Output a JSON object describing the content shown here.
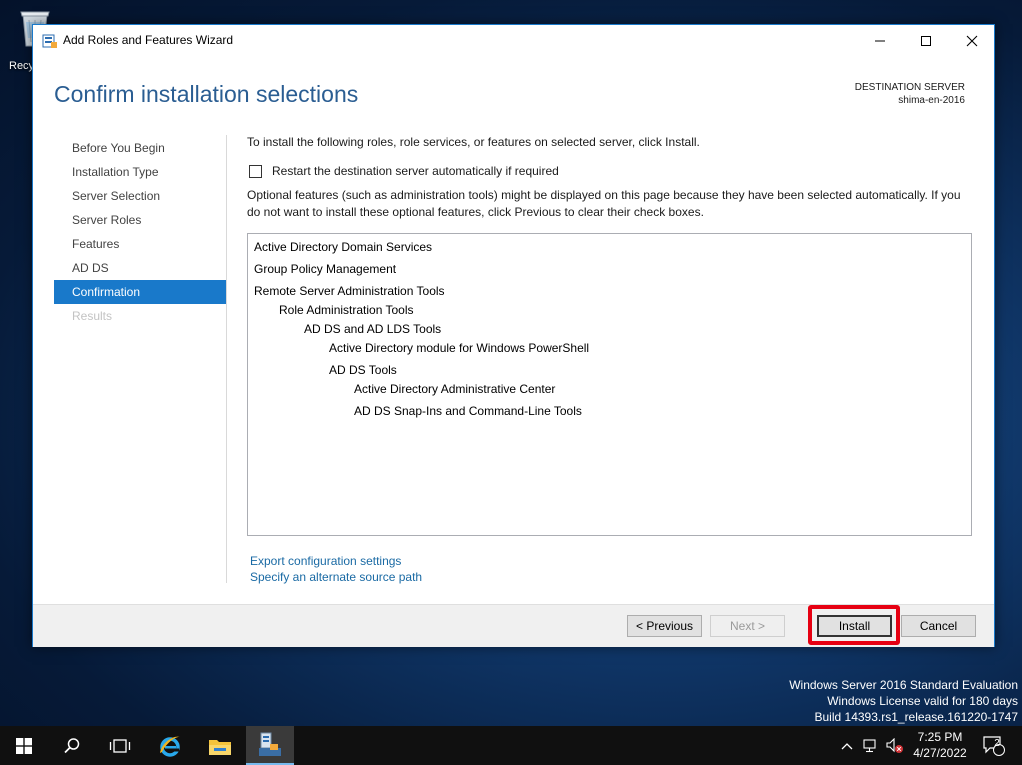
{
  "desktop": {
    "recycle_label": "Recy"
  },
  "window": {
    "title": "Add Roles and Features Wizard",
    "page_title": "Confirm installation selections",
    "destination_label": "DESTINATION SERVER",
    "destination_server": "shima-en-2016"
  },
  "nav": {
    "items": [
      {
        "label": "Before You Begin",
        "state": "normal"
      },
      {
        "label": "Installation Type",
        "state": "normal"
      },
      {
        "label": "Server Selection",
        "state": "normal"
      },
      {
        "label": "Server Roles",
        "state": "normal"
      },
      {
        "label": "Features",
        "state": "normal"
      },
      {
        "label": "AD DS",
        "state": "normal"
      },
      {
        "label": "Confirmation",
        "state": "active"
      },
      {
        "label": "Results",
        "state": "disabled"
      }
    ]
  },
  "content": {
    "intro": "To install the following roles, role services, or features on selected server, click Install.",
    "restart_label": "Restart the destination server automatically if required",
    "optional_text": "Optional features (such as administration tools) might be displayed on this page because they have been selected automatically. If you do not want to install these optional features, click Previous to clear their check boxes.",
    "selections": [
      {
        "label": "Active Directory Domain Services",
        "level": 0
      },
      {
        "label": "Group Policy Management",
        "level": 0
      },
      {
        "label": "Remote Server Administration Tools",
        "level": 0
      },
      {
        "label": "Role Administration Tools",
        "level": 1
      },
      {
        "label": "AD DS and AD LDS Tools",
        "level": 2
      },
      {
        "label": "Active Directory module for Windows PowerShell",
        "level": 3
      },
      {
        "label": "AD DS Tools",
        "level": 3
      },
      {
        "label": "Active Directory Administrative Center",
        "level": 4
      },
      {
        "label": "AD DS Snap-Ins and Command-Line Tools",
        "level": 4
      }
    ],
    "export_link": "Export configuration settings",
    "source_link": "Specify an alternate source path"
  },
  "buttons": {
    "previous": "< Previous",
    "next": "Next >",
    "install": "Install",
    "cancel": "Cancel"
  },
  "watermark": {
    "line1": "Windows Server 2016 Standard Evaluation",
    "line2": "Windows License valid for 180 days",
    "line3": "Build 14393.rs1_release.161220-1747"
  },
  "taskbar": {
    "time": "7:25 PM",
    "date": "4/27/2022",
    "notification_count": "2"
  },
  "colors": {
    "accent": "#1979ca",
    "title_blue": "#2a5d92",
    "link_blue": "#1a6aa4",
    "highlight_red": "#e60012"
  }
}
